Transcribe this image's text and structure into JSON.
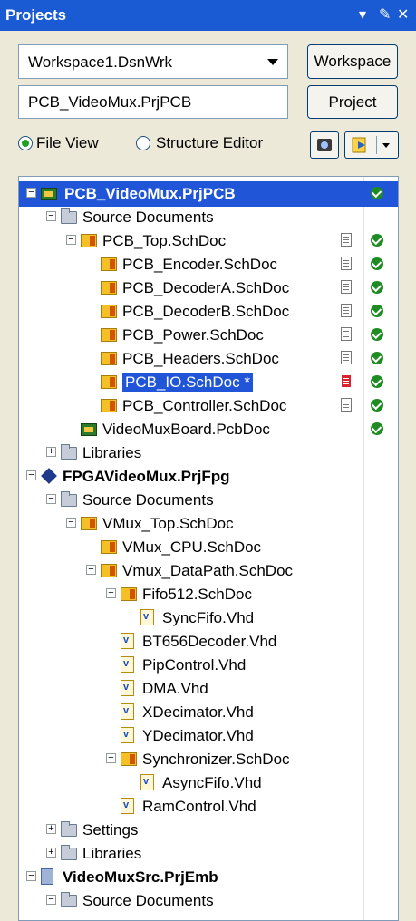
{
  "panel": {
    "title": "Projects",
    "controls": [
      "▾",
      "✎",
      "✕"
    ]
  },
  "workspace": {
    "combo_value": "Workspace1.DsnWrk",
    "button": "Workspace"
  },
  "project": {
    "field_value": "PCB_VideoMux.PrjPCB",
    "button": "Project"
  },
  "view": {
    "file_view": "File View",
    "structure_editor": "Structure Editor",
    "selected": "file_view"
  },
  "tree": [
    {
      "label": "PCB_VideoMux.PrjPCB",
      "expander": "minus",
      "icon": "pcb-project",
      "bold": true,
      "selected": true,
      "check": true,
      "doc": null
    },
    {
      "label": "Source Documents",
      "expander": "minus",
      "icon": "folder",
      "check": false,
      "doc": null
    },
    {
      "label": "PCB_Top.SchDoc",
      "expander": "minus",
      "icon": "schematic",
      "check": true,
      "doc": "doc"
    },
    {
      "label": "PCB_Encoder.SchDoc",
      "expander": null,
      "icon": "schematic",
      "check": true,
      "doc": "doc"
    },
    {
      "label": "PCB_DecoderA.SchDoc",
      "expander": null,
      "icon": "schematic",
      "check": true,
      "doc": "doc"
    },
    {
      "label": "PCB_DecoderB.SchDoc",
      "expander": null,
      "icon": "schematic",
      "check": true,
      "doc": "doc"
    },
    {
      "label": "PCB_Power.SchDoc",
      "expander": null,
      "icon": "schematic",
      "check": true,
      "doc": "doc"
    },
    {
      "label": "PCB_Headers.SchDoc",
      "expander": null,
      "icon": "schematic",
      "check": true,
      "doc": "doc"
    },
    {
      "label": "PCB_IO.SchDoc *",
      "expander": null,
      "icon": "schematic",
      "check": true,
      "doc": "modified",
      "highlight": true
    },
    {
      "label": "PCB_Controller.SchDoc",
      "expander": null,
      "icon": "schematic",
      "check": true,
      "doc": "doc"
    },
    {
      "label": "VideoMuxBoard.PcbDoc",
      "expander": null,
      "icon": "pcb-doc",
      "check": true,
      "doc": null
    },
    {
      "label": "Libraries",
      "expander": "plus",
      "icon": "folder",
      "check": false,
      "doc": null
    },
    {
      "label": "FPGAVideoMux.PrjFpg",
      "expander": "minus",
      "icon": "fpga-project",
      "bold": true,
      "check": false,
      "doc": null
    },
    {
      "label": "Source Documents",
      "expander": "minus",
      "icon": "folder",
      "check": false,
      "doc": null
    },
    {
      "label": "VMux_Top.SchDoc",
      "expander": "minus",
      "icon": "schematic",
      "check": false,
      "doc": null
    },
    {
      "label": "VMux_CPU.SchDoc",
      "expander": null,
      "icon": "schematic",
      "check": false,
      "doc": null
    },
    {
      "label": "Vmux_DataPath.SchDoc",
      "expander": "minus",
      "icon": "schematic",
      "check": false,
      "doc": null
    },
    {
      "label": "Fifo512.SchDoc",
      "expander": "minus",
      "icon": "schematic",
      "check": false,
      "doc": null
    },
    {
      "label": "SyncFifo.Vhd",
      "expander": null,
      "icon": "vhdl",
      "check": false,
      "doc": null
    },
    {
      "label": "BT656Decoder.Vhd",
      "expander": null,
      "icon": "vhdl",
      "check": false,
      "doc": null
    },
    {
      "label": "PipControl.Vhd",
      "expander": null,
      "icon": "vhdl",
      "check": false,
      "doc": null
    },
    {
      "label": "DMA.Vhd",
      "expander": null,
      "icon": "vhdl",
      "check": false,
      "doc": null
    },
    {
      "label": "XDecimator.Vhd",
      "expander": null,
      "icon": "vhdl",
      "check": false,
      "doc": null
    },
    {
      "label": "YDecimator.Vhd",
      "expander": null,
      "icon": "vhdl",
      "check": false,
      "doc": null
    },
    {
      "label": "Synchronizer.SchDoc",
      "expander": "minus",
      "icon": "schematic",
      "check": false,
      "doc": null
    },
    {
      "label": "AsyncFifo.Vhd",
      "expander": null,
      "icon": "vhdl",
      "check": false,
      "doc": null
    },
    {
      "label": "RamControl.Vhd",
      "expander": null,
      "icon": "vhdl",
      "check": false,
      "doc": null
    },
    {
      "label": "Settings",
      "expander": "plus",
      "icon": "folder",
      "check": false,
      "doc": null
    },
    {
      "label": "Libraries",
      "expander": "plus",
      "icon": "folder",
      "check": false,
      "doc": null
    },
    {
      "label": "VideoMuxSrc.PrjEmb",
      "expander": "minus",
      "icon": "embedded-project",
      "bold": true,
      "check": false,
      "doc": null
    },
    {
      "label": "Source Documents",
      "expander": "minus",
      "icon": "folder",
      "check": false,
      "doc": null
    }
  ]
}
